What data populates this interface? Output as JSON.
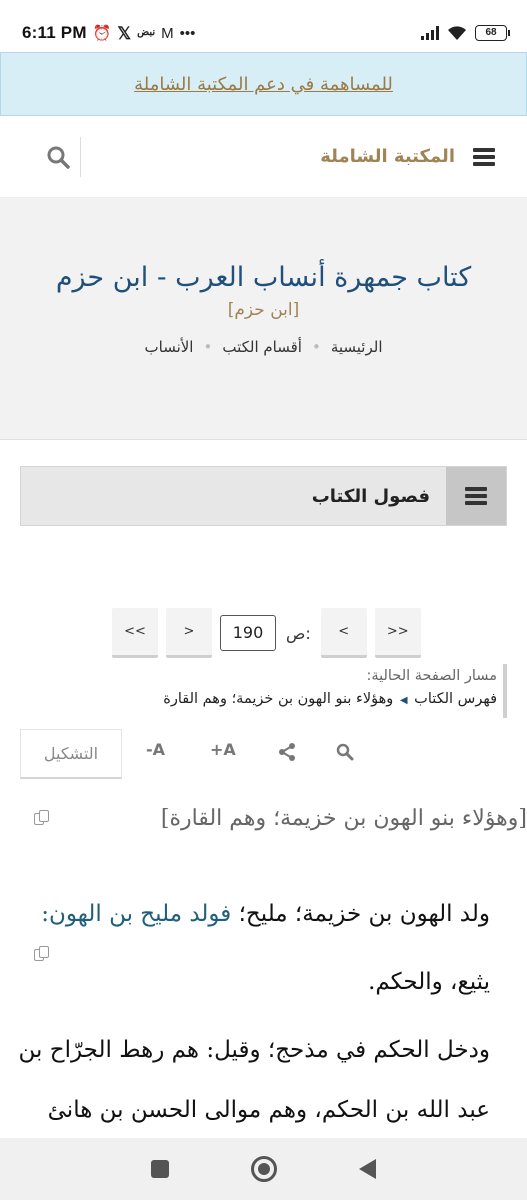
{
  "status_bar": {
    "time": "6:11 PM",
    "alarm_icon": "alarm-icon",
    "x_app": "𝕏",
    "carrier_label": "نبض",
    "gmail_icon": "M",
    "more": "•••",
    "battery": "68"
  },
  "donate_banner": {
    "text": "للمساهمة في دعم المكتبة الشاملة"
  },
  "header": {
    "brand": "المكتبة الشاملة",
    "menu_icon": "hamburger-icon",
    "search_icon": "search-icon"
  },
  "book": {
    "title": "كتاب جمهرة أنساب العرب - ابن حزم",
    "author": "[ابن حزم]",
    "breadcrumbs": [
      "الرئيسية",
      "أقسام الكتب",
      "الأنساب"
    ]
  },
  "chapters": {
    "label": "فصول الكتاب"
  },
  "pagination": {
    "first": "<<",
    "prev": "<",
    "page_label": "ص:",
    "page_value": "190",
    "next": ">",
    "last": ">>"
  },
  "path": {
    "label": "مسار الصفحة الحالية:",
    "root": "فهرس الكتاب",
    "current": "وهؤلاء بنو الهون بن خزيمة؛ وهم القارة"
  },
  "toolbar": {
    "tashkeel": "التشكيل",
    "font_decrease": "-A",
    "font_increase": "+A",
    "share_icon": "share-icon",
    "search_icon": "search-icon"
  },
  "content": {
    "heading": "[وهؤلاء بنو الهون بن خزيمة؛ وهم القارة]",
    "p1_plain": "ولد الهون بن خزيمة؛ مليح؛ ",
    "p1_highlight": "فولد مليح بن الهون:",
    "p1_line2": "يثيع، والحكم.",
    "p2_line1": "ودخل الحكم في مذحج؛ وقيل: هم رهط الجرّاح بن",
    "p2_line2": "عبد الله بن الحكم، وهم موالى الحسن بن هانئ"
  }
}
